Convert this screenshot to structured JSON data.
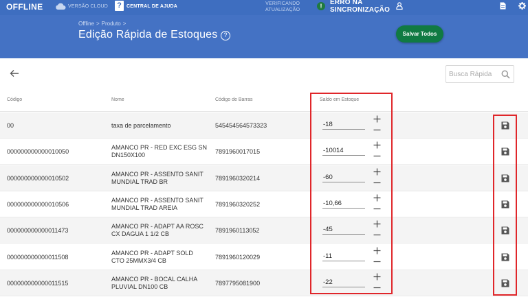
{
  "topbar": {
    "brand": "OFFLINE",
    "cloud_label": "VERSÃO CLOUD",
    "help_label": "CENTRAL DE AJUDA",
    "verify_line1": "VERIFICANDO",
    "verify_line2": "ATUALIZAÇÃO",
    "sync_line1": "ERRO NA",
    "sync_line2": "SINCRONIZAÇÃO",
    "icons": [
      "cloud-icon",
      "help-icon",
      "sync-status-icon",
      "user-icon",
      "document-icon",
      "gear-icon"
    ]
  },
  "header": {
    "breadcrumb": [
      "Offline",
      "Produto"
    ],
    "title": "Edição Rápida de Estoques",
    "save_all_label": "Salvar Todos"
  },
  "search": {
    "placeholder": "Busca Rápida"
  },
  "table": {
    "columns": [
      "Código",
      "Nome",
      "Código de Barras",
      "Saldo em Estoque"
    ],
    "rows": [
      {
        "code": "00",
        "name": "taxa de parcelamento",
        "barcode": "545454564573323",
        "stock": "-18"
      },
      {
        "code": "000000000000010050",
        "name": "AMANCO PR - RED EXC ESG SN DN150X100",
        "barcode": "7891960017015",
        "stock": "-10014"
      },
      {
        "code": "000000000000010502",
        "name": "AMANCO PR - ASSENTO SANIT MUNDIAL TRAD BR",
        "barcode": "7891960320214",
        "stock": "-60"
      },
      {
        "code": "000000000000010506",
        "name": "AMANCO PR - ASSENTO SANIT MUNDIAL TRAD AREIA",
        "barcode": "7891960320252",
        "stock": "-10,66"
      },
      {
        "code": "000000000000011473",
        "name": "AMANCO PR - ADAPT AA ROSC CX DAGUA 1 1/2 CB",
        "barcode": "7891960113052",
        "stock": "-45"
      },
      {
        "code": "000000000000011508",
        "name": "AMANCO PR - ADAPT SOLD CTO 25MMX3/4 CB",
        "barcode": "7891960120029",
        "stock": "-11"
      },
      {
        "code": "000000000000011515",
        "name": "AMANCO PR - BOCAL CALHA PLUVIAL DN100 CB",
        "barcode": "7897795081900",
        "stock": "-22"
      }
    ]
  },
  "colors": {
    "topbar": "#3e6ec0",
    "header": "#4472c4",
    "save_all": "#107a42",
    "highlight": "#e0262a",
    "sync_status": "#1f7a3f"
  }
}
